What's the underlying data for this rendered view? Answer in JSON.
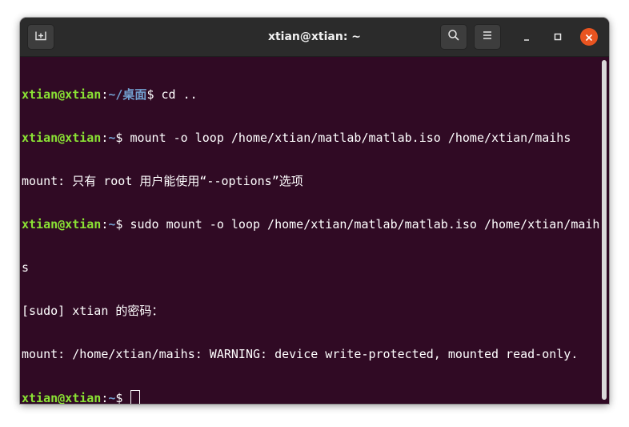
{
  "window": {
    "title": "xtian@xtian: ~"
  },
  "toolbar": {
    "new_tab_icon": "new-tab-icon",
    "search_icon": "search-icon",
    "menu_icon": "hamburger-menu-icon",
    "minimize_icon": "minimize-icon",
    "maximize_icon": "maximize-icon",
    "close_icon": "close-icon"
  },
  "colors": {
    "terminal_bg": "#300a24",
    "prompt_user": "#8ae234",
    "prompt_path": "#729fcf",
    "close_button": "#e95420"
  },
  "terminal": {
    "lines": [
      {
        "user": "xtian@xtian",
        "sep": ":",
        "path": "~/桌面",
        "cmd": "$ cd .."
      },
      {
        "user": "xtian@xtian",
        "sep": ":",
        "path": "~",
        "cmd": "$ mount -o loop /home/xtian/matlab/matlab.iso /home/xtian/maihs"
      },
      {
        "text": "mount: 只有 root 用户能使用“--options”选项"
      },
      {
        "user": "xtian@xtian",
        "sep": ":",
        "path": "~",
        "cmd": "$ sudo mount -o loop /home/xtian/matlab/matlab.iso /home/xtian/maih"
      },
      {
        "text": "s"
      },
      {
        "text": "[sudo] xtian 的密码："
      },
      {
        "text": "mount: /home/xtian/maihs: WARNING: device write-protected, mounted read-only."
      },
      {
        "user": "xtian@xtian",
        "sep": ":",
        "path": "~",
        "cmd": "$ ",
        "cursor": true
      }
    ]
  }
}
